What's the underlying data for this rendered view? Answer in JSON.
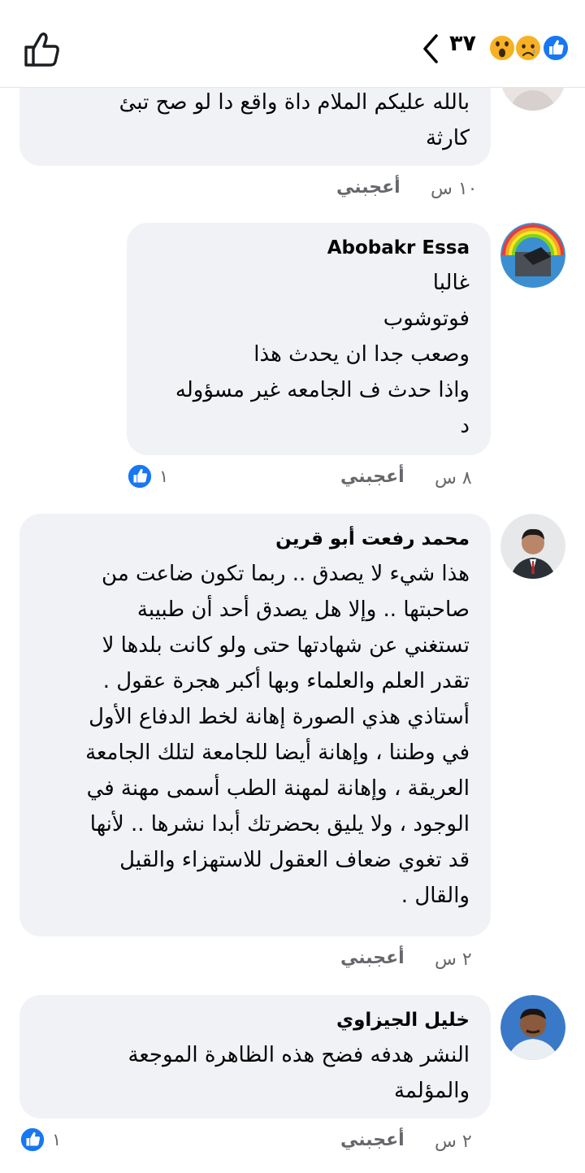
{
  "header": {
    "reaction_count": "٣٧",
    "reactions": [
      "like-icon",
      "sad-icon",
      "wow-icon"
    ],
    "like_color": "#1877f2"
  },
  "comments": [
    {
      "name": "",
      "text": "بالله عليكم الملام داة واقع  دا لو صح تبئ\nكارثة",
      "time": "١٠ س",
      "like_label": "أعجبني",
      "reactions": ""
    },
    {
      "name": "Abobakr Essa",
      "text": "غالبا\nفوتوشوب\nوصعب جدا ان يحدث هذا\nواذا حدث  ف الجامعه غير مسؤوله\nد",
      "time": "٨ س",
      "like_label": "أعجبني",
      "reactions": "١"
    },
    {
      "name": "محمد رفعت أبو قرين",
      "text": "هذا شيء لا يصدق .. ربما تكون ضاعت من\nصاحبتها .. وإلا هل يصدق أحد أن طبيبة\nتستغني عن شهادتها حتى ولو كانت بلدها لا\nتقدر العلم والعلماء وبها أكبر هجرة عقول .\nأستاذي هذي الصورة إهانة لخط الدفاع الأول\nفي وطننا ، وإهانة أيضا للجامعة لتلك الجامعة\nالعريقة ، وإهانة لمهنة الطب أسمى مهنة في\nالوجود ، ولا يليق بحضرتك أبدا نشرها .. لأنها\nقد تغوي ضعاف العقول للاستهزاء والقيل\nوالقال .",
      "time": "٢ س",
      "like_label": "أعجبني",
      "reactions": ""
    },
    {
      "name": "خليل الجيزاوي",
      "text": "النشر هدفه فضح هذه الظاهرة الموجعة\nوالمؤلمة",
      "time": "٢ س",
      "like_label": "أعجبني",
      "reactions": "١"
    }
  ]
}
